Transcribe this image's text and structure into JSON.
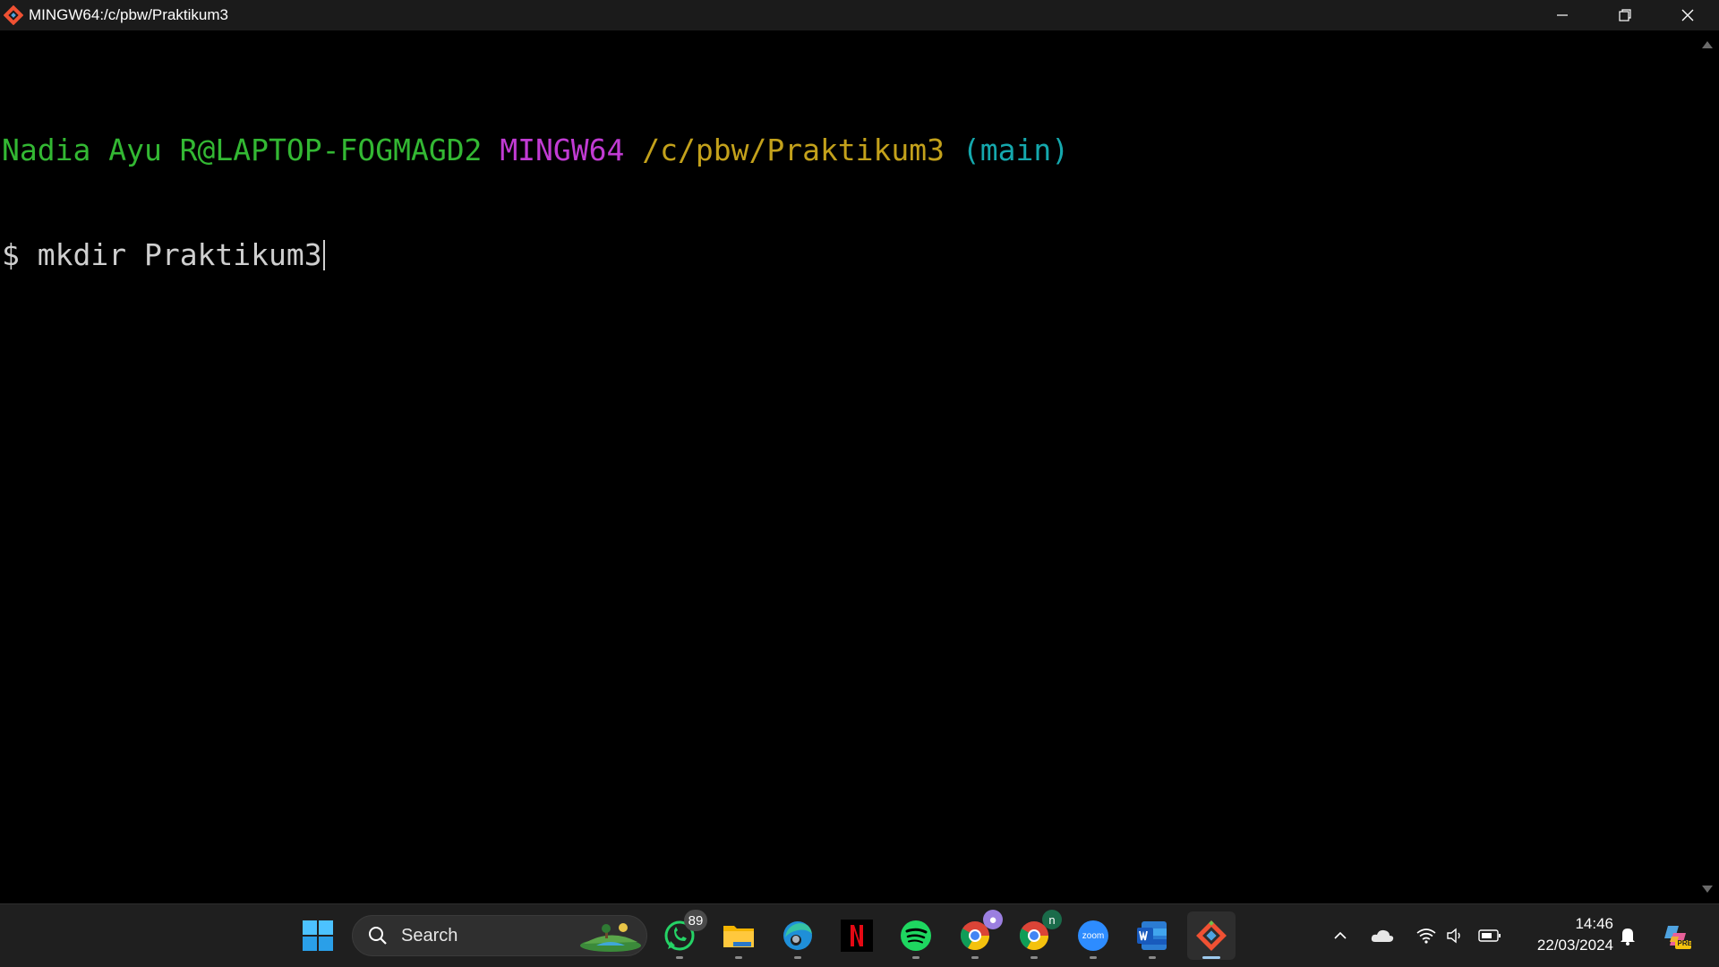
{
  "window": {
    "title": "MINGW64:/c/pbw/Praktikum3"
  },
  "terminal": {
    "prompt": {
      "user_host": "Nadia Ayu R@LAPTOP-FOGMAGD2",
      "system": "MINGW64",
      "path": "/c/pbw/Praktikum3",
      "branch": "(main)"
    },
    "prompt_symbol": "$",
    "command": "mkdir Praktikum3"
  },
  "taskbar": {
    "search_placeholder": "Search",
    "apps": [
      {
        "name": "WhatsApp",
        "badge": "89"
      },
      {
        "name": "File Explorer"
      },
      {
        "name": "Microsoft Edge"
      },
      {
        "name": "Netflix"
      },
      {
        "name": "Spotify"
      },
      {
        "name": "Google Chrome (profile)"
      },
      {
        "name": "Google Chrome (profile n)"
      },
      {
        "name": "Zoom"
      },
      {
        "name": "Microsoft Word"
      },
      {
        "name": "Git Bash",
        "active": true
      }
    ],
    "zoom_label": "zoom",
    "chrome_profile_letter": "n",
    "copilot_badge": "PRE",
    "clock": {
      "time": "14:46",
      "date": "22/03/2024"
    }
  },
  "colors": {
    "terminal_bg": "#000000",
    "prompt_user": "#33b833",
    "prompt_system": "#c13bd3",
    "prompt_path": "#c3a11b",
    "prompt_branch": "#15a8ad",
    "command_text": "#cfcfcf",
    "taskbar_bg": "#1f1f1f"
  }
}
